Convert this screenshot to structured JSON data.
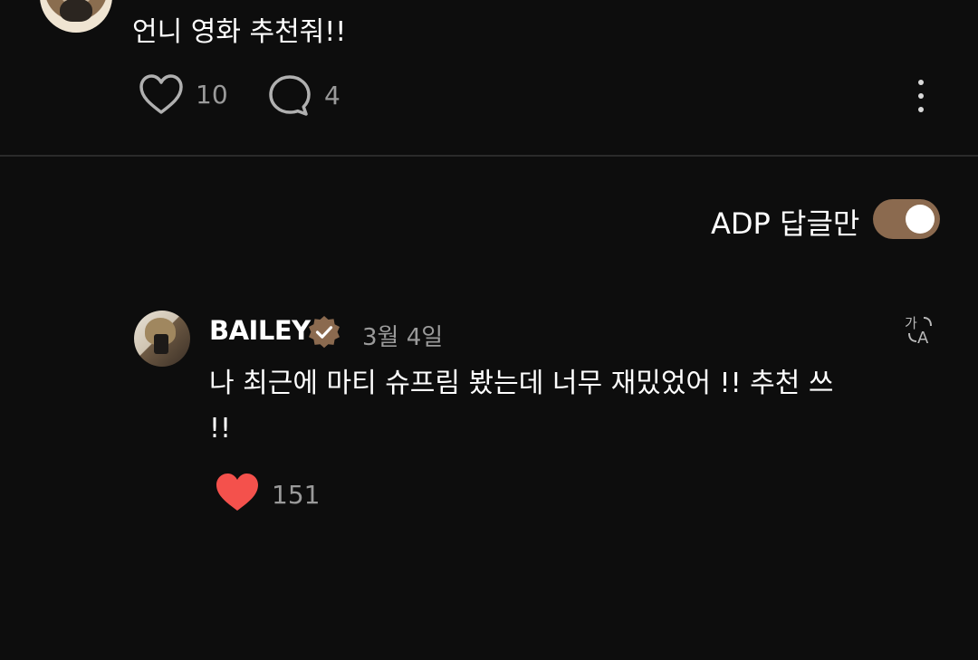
{
  "post": {
    "text": "언니 영화 추천줘!!",
    "likes": "10",
    "comments": "4"
  },
  "filter": {
    "label": "ADP 답글만",
    "toggle_on": true
  },
  "reply": {
    "author": "BAILEY",
    "date": "3월 4일",
    "text": "나 최근에 마티 슈프림 봤는데 너무 재밌었어 !! 추천 쓰 !!",
    "likes": "151"
  },
  "icons": {
    "like": "heart-outline-icon",
    "comment": "comment-bubble-icon",
    "more": "more-vertical-icon",
    "verified": "verified-badge-icon",
    "translate": "translate-icon",
    "liked": "heart-filled-icon"
  },
  "colors": {
    "background": "#0d0d0d",
    "accent": "#8b6a4f",
    "liked_heart": "#f4514c",
    "muted_text": "#9a9a9a"
  }
}
